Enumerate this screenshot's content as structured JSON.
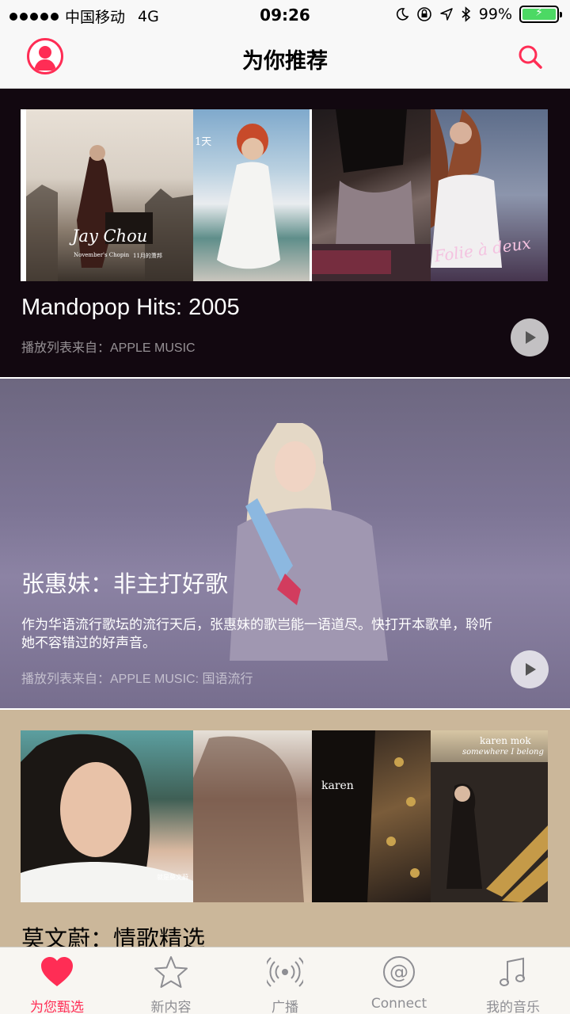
{
  "status_bar": {
    "carrier": "中国移动",
    "network": "4G",
    "time": "09:26",
    "battery_percent": "99%",
    "battery_level": 0.99
  },
  "nav": {
    "title": "为你推荐"
  },
  "cards": [
    {
      "title": "Mandopop Hits: 2005",
      "subtitle": "播放列表来自：APPLE MUSIC",
      "album_texts": [
        "Jay Chou",
        "November's Chopin",
        "11月的萧邦",
        "1天",
        "Folie à deux"
      ]
    },
    {
      "title": "张惠妹：非主打好歌",
      "description": "作为华语流行歌坛的流行天后，张惠妹的歌岂能一语道尽。快打开本歌单，聆听她不容错过的好声音。",
      "subtitle": "播放列表来自：APPLE MUSIC: 国语流行"
    },
    {
      "title": "莫文蔚：情歌精选",
      "album_texts": [
        "就是莫文蔚",
        "karen",
        "karen mok",
        "somewhere I belong"
      ]
    }
  ],
  "tabs": [
    {
      "label": "为您甄选",
      "icon": "heart-icon",
      "active": true
    },
    {
      "label": "新内容",
      "icon": "star-icon",
      "active": false
    },
    {
      "label": "广播",
      "icon": "radio-icon",
      "active": false
    },
    {
      "label": "Connect",
      "icon": "at-icon",
      "active": false
    },
    {
      "label": "我的音乐",
      "icon": "music-note-icon",
      "active": false
    }
  ],
  "colors": {
    "accent": "#ff2d55",
    "inactive": "#8e8e93",
    "battery": "#4cd964"
  }
}
